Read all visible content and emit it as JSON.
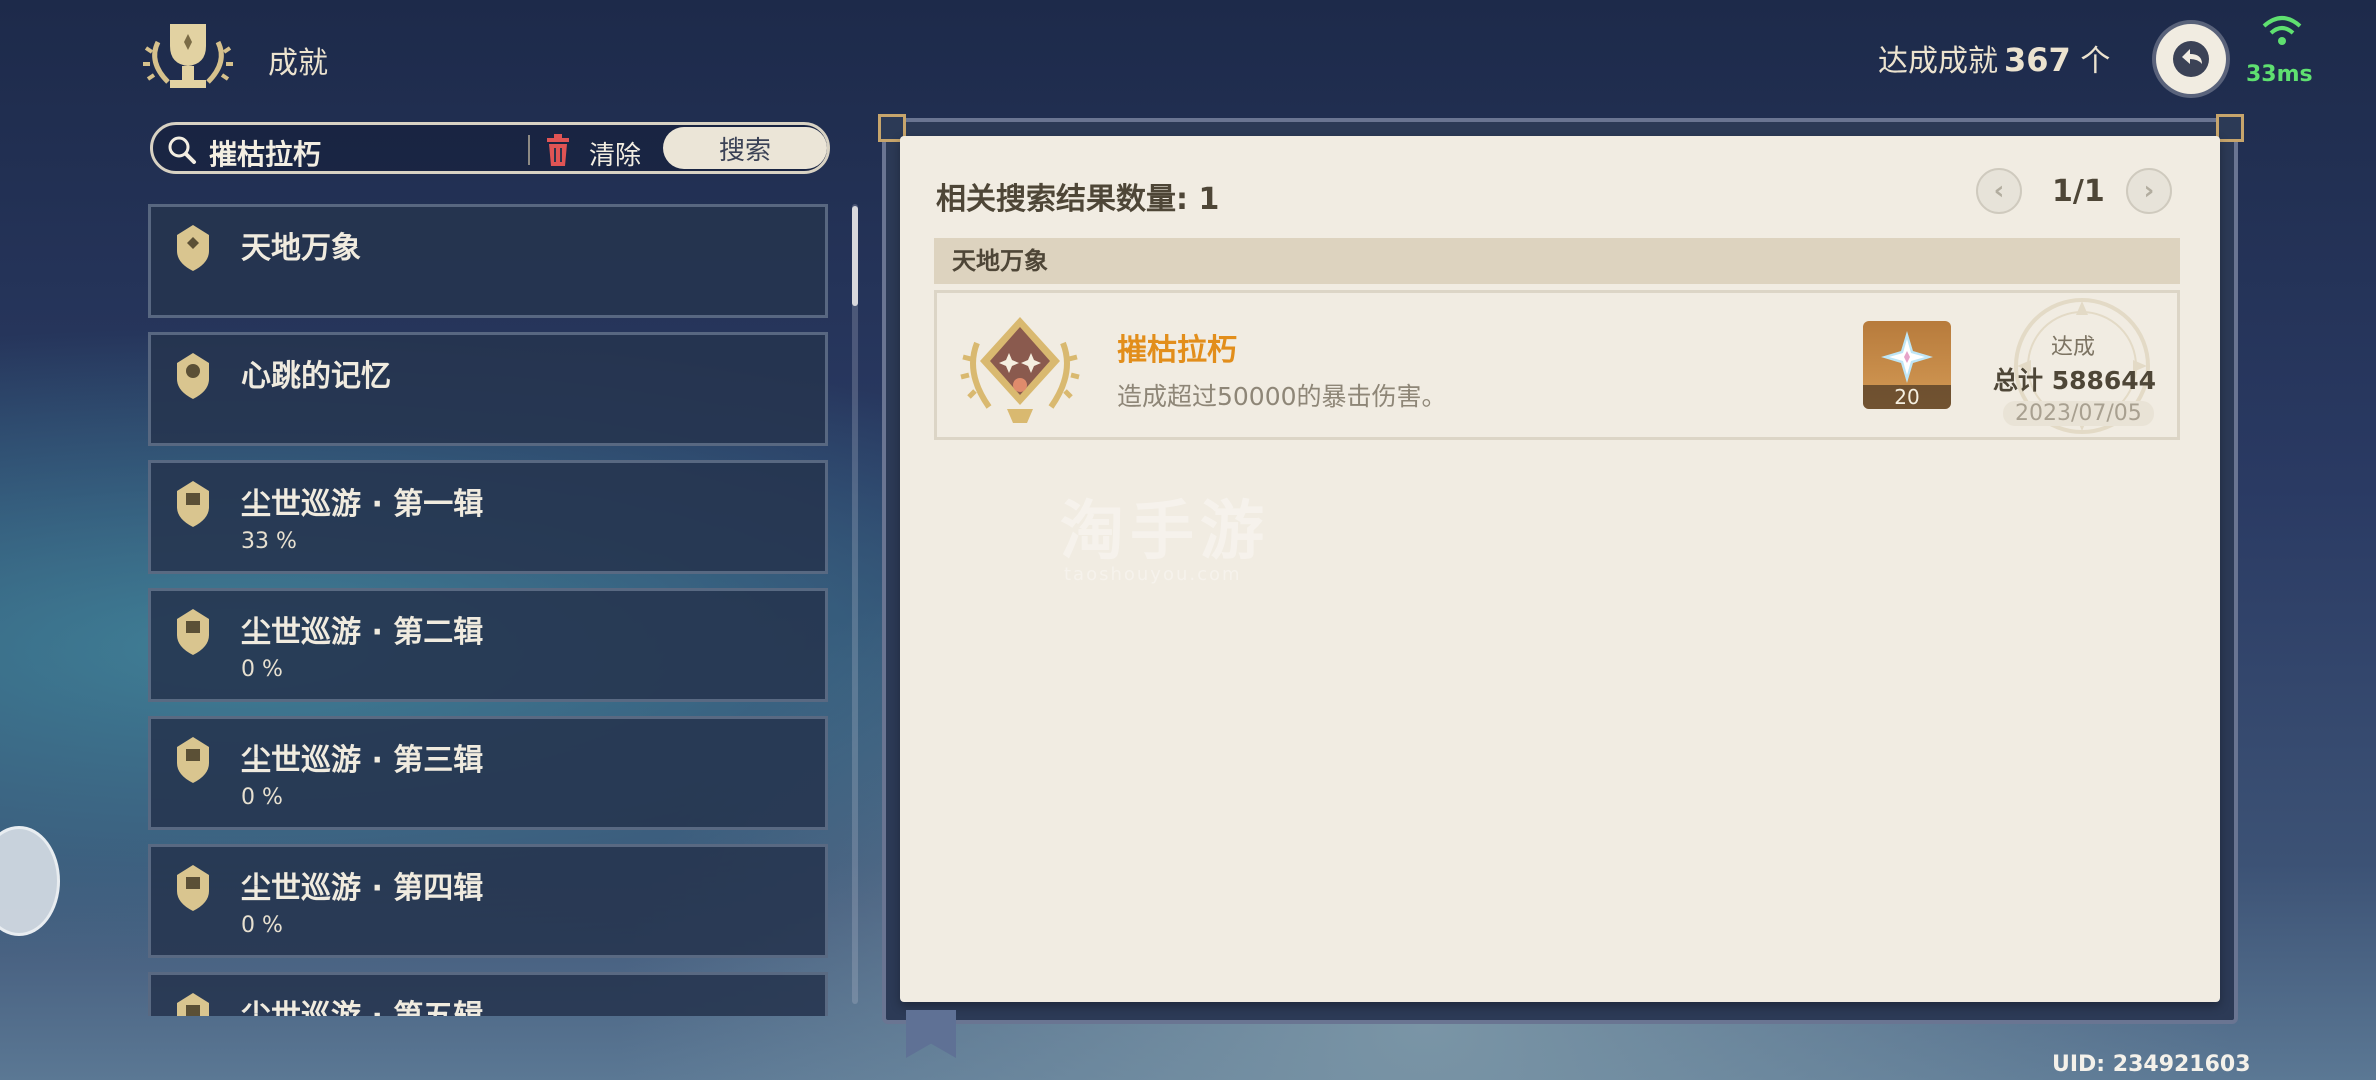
{
  "header": {
    "title": "成就",
    "achieved_label": "达成成就",
    "achieved_count": "367",
    "achieved_unit": "个",
    "ping": "33ms",
    "ping_color": "#5fe070"
  },
  "search": {
    "query": "摧枯拉朽",
    "clear_label": "清除",
    "search_button": "搜索"
  },
  "categories": [
    {
      "name": "天地万象",
      "progress": ""
    },
    {
      "name": "心跳的记忆",
      "progress": ""
    },
    {
      "name": "尘世巡游 · 第一辑",
      "progress": "33 %"
    },
    {
      "name": "尘世巡游 · 第二辑",
      "progress": "0 %"
    },
    {
      "name": "尘世巡游 · 第三辑",
      "progress": "0 %"
    },
    {
      "name": "尘世巡游 · 第四辑",
      "progress": "0 %"
    },
    {
      "name": "尘世巡游 · 第五辑",
      "progress": ""
    }
  ],
  "results": {
    "count_label": "相关搜索结果数量: 1",
    "page": "1/1",
    "group": "天地万象",
    "achievement": {
      "name": "摧枯拉朽",
      "description": "造成超过50000的暴击伤害。",
      "reward_qty": "20",
      "reward_icon": "primogem-icon",
      "status": "达成",
      "total": "总计 588644",
      "date": "2023/07/05"
    }
  },
  "watermark": {
    "line1": "淘手游",
    "line2": "taoshouyou.com"
  },
  "footer": {
    "uid": "UID: 234921603"
  },
  "colors": {
    "accent": "#e28e1b",
    "paper": "#f1ece2"
  }
}
